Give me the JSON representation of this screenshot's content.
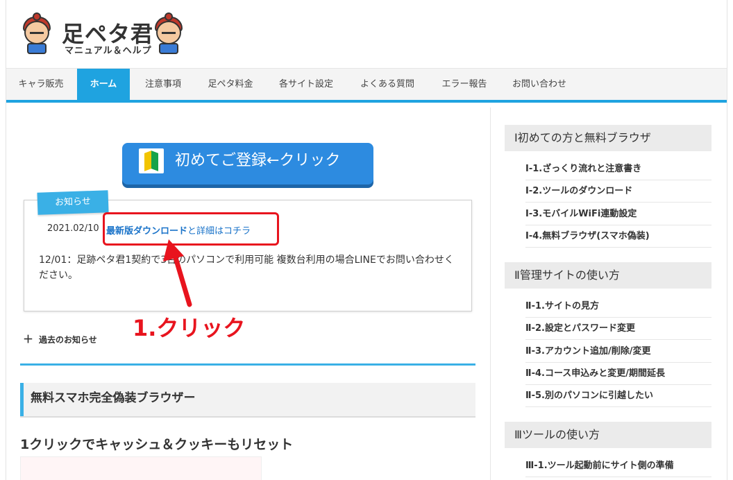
{
  "header": {
    "logo_title": "足ペタ君",
    "logo_subtitle": "マニュアル＆ヘルプ"
  },
  "nav": {
    "items": [
      {
        "label": "キャラ販売"
      },
      {
        "label": "ホーム"
      },
      {
        "label": "注意事項"
      },
      {
        "label": "足ペタ料金"
      },
      {
        "label": "各サイト設定"
      },
      {
        "label": "よくある質問"
      },
      {
        "label": "エラー報告"
      },
      {
        "label": "お問い合わせ"
      }
    ],
    "active_index": 1,
    "accent_color": "#1fa3e0"
  },
  "main": {
    "register_button": "初めてご登録←クリック",
    "notice": {
      "label": "お知らせ",
      "date": "2021.02/10",
      "link_bold": "最新版ダウンロード",
      "link_rest": "と詳細はコチラ",
      "text": "12/01：足跡ペタ君1契約で3台のパソコンで利用可能 複数台利用の場合LINEでお問い合わせください。"
    },
    "annotation": "1.クリック",
    "annotation_color": "#e8141e",
    "past_news": "過去のお知らせ",
    "section_title": "無料スマホ完全偽装ブラウザー",
    "sub_title": "1クリックでキャッシュ＆クッキーもリセット"
  },
  "sidebar": {
    "sections": [
      {
        "title": "Ⅰ初めての方と無料ブラウザ",
        "items": [
          "Ⅰ-1.ざっくり流れと注意書き",
          "Ⅰ-2.ツールのダウンロード",
          "Ⅰ-3.モバイルWiFi連動設定",
          "Ⅰ-4.無料ブラウザ(スマホ偽装)"
        ]
      },
      {
        "title": "Ⅱ管理サイトの使い方",
        "items": [
          "Ⅱ-1.サイトの見方",
          "Ⅱ-2.設定とパスワード変更",
          "Ⅱ-3.アカウント追加/削除/変更",
          "Ⅱ-4.コース申込みと変更/期間延長",
          "Ⅱ-5.別のパソコンに引越したい"
        ]
      },
      {
        "title": "Ⅲツールの使い方",
        "items": [
          "Ⅲ-1.ツール起動前にサイト側の準備"
        ]
      }
    ]
  }
}
